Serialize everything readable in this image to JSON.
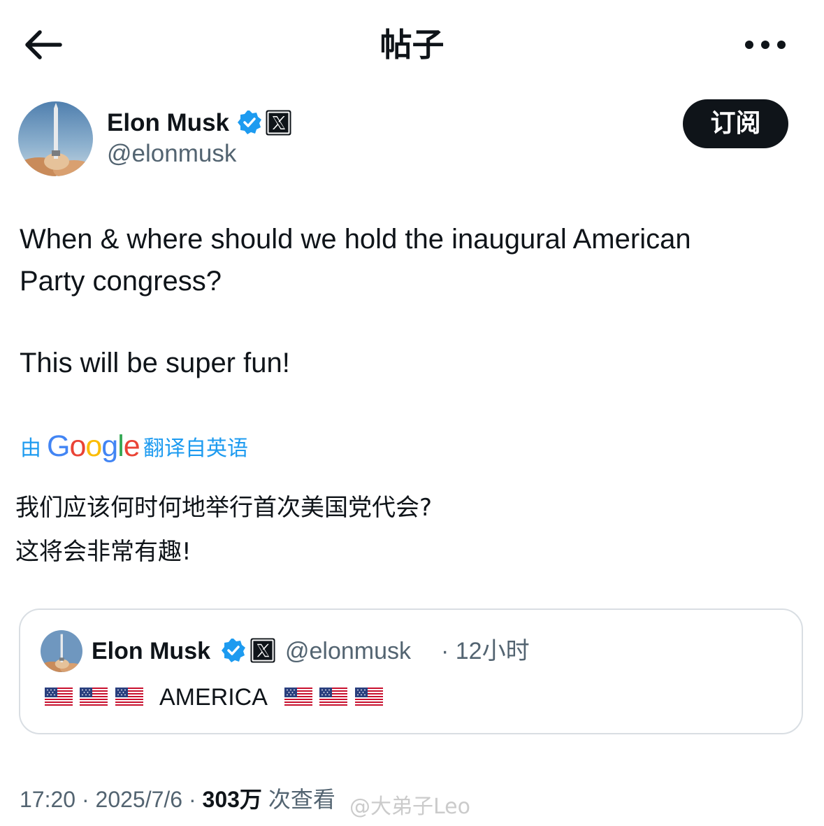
{
  "header": {
    "title": "帖子"
  },
  "author": {
    "name": "Elon Musk",
    "handle": "@elonmusk",
    "subscribe_label": "订阅"
  },
  "tweet": {
    "line1": "When & where should we hold the inaugural American",
    "line2": "Party congress?",
    "line3": "This will be super fun!"
  },
  "translation": {
    "by": "由",
    "provider": "Google",
    "from": "翻译自英语",
    "line1": "我们应该何时何地举行首次美国党代会?",
    "line2": "这将会非常有趣!"
  },
  "quote": {
    "name": "Elon Musk",
    "handle": "@elonmusk",
    "time": "· 12小时",
    "text": "AMERICA",
    "flag_emoji": "🇺🇸"
  },
  "meta": {
    "time": "17:20",
    "sep1": " · ",
    "date": "2025/7/6",
    "sep2": " · ",
    "views": "303万",
    "views_suffix": " 次查看"
  },
  "watermark": "@大弟子Leo",
  "icons": {
    "back": "arrow-left-icon",
    "more": "more-dots-icon",
    "verified": "verified-badge-icon",
    "affiliate": "x-logo-icon"
  },
  "colors": {
    "accent": "#1d9bf0",
    "text": "#0f1419",
    "muted": "#536471",
    "border": "#d9dee3"
  }
}
